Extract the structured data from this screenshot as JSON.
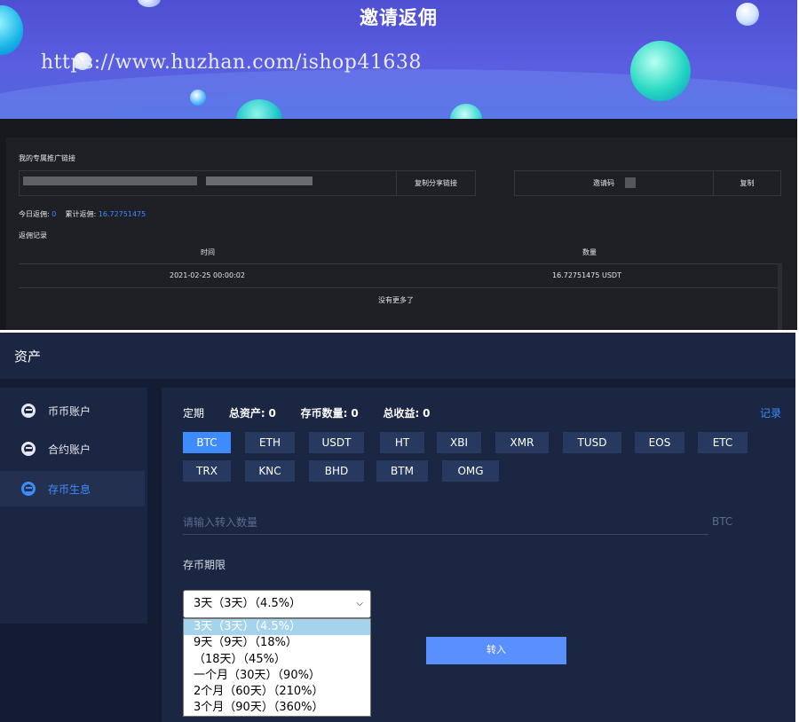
{
  "banner": {
    "title": "邀请返佣",
    "url": "https://www.huzhan.com/ishop41638"
  },
  "invite": {
    "link_label": "我的专属推广链接",
    "copy_share_label": "复制分享链接",
    "code_label": "邀请码",
    "code_copy_label": "复制",
    "today_label": "今日返佣:",
    "today_value": "0",
    "total_label": "累计返佣:",
    "total_value": "16.72751475",
    "records_label": "返佣记录",
    "table": {
      "headers": [
        "时间",
        "数量"
      ],
      "rows": [
        [
          "2021-02-25 00:00:02",
          "16.72751475 USDT"
        ]
      ],
      "no_more": "没有更多了"
    }
  },
  "asset": {
    "title": "资产",
    "sidebar": [
      {
        "label": "币币账户",
        "icon": "exchange-icon",
        "active": false
      },
      {
        "label": "合约账户",
        "icon": "exchange-icon",
        "active": false
      },
      {
        "label": "存币生息",
        "icon": "exchange-icon",
        "active": true
      }
    ],
    "summary": {
      "type": "定期",
      "total_assets_label": "总资产:",
      "total_assets_value": "0",
      "deposit_label": "存币数量:",
      "deposit_value": "0",
      "profit_label": "总收益:",
      "profit_value": "0"
    },
    "record_link": "记录",
    "coins": [
      "BTC",
      "ETH",
      "USDT",
      "HT",
      "XBI",
      "XMR",
      "TUSD",
      "EOS",
      "ETC",
      "TRX",
      "KNC",
      "BHD",
      "BTM",
      "OMG"
    ],
    "active_coin": "BTC",
    "amount_placeholder": "请输入转入数量",
    "unit": "BTC",
    "period_label": "存币期限",
    "period_selected": "3天（3天）（4.5%）",
    "period_options": [
      "3天（3天）（4.5%）",
      "9天（9天）（18%）",
      "（18天）（45%）",
      "一个月（30天）（90%）",
      "2个月（60天）（210%）",
      "3个月（90天）（360%）"
    ],
    "submit_label": "转入"
  },
  "colors": {
    "accent": "#3d8bff",
    "banner": "#5a5ee0",
    "dark_panel": "#1e2025",
    "asset_bg": "#1b2643"
  }
}
